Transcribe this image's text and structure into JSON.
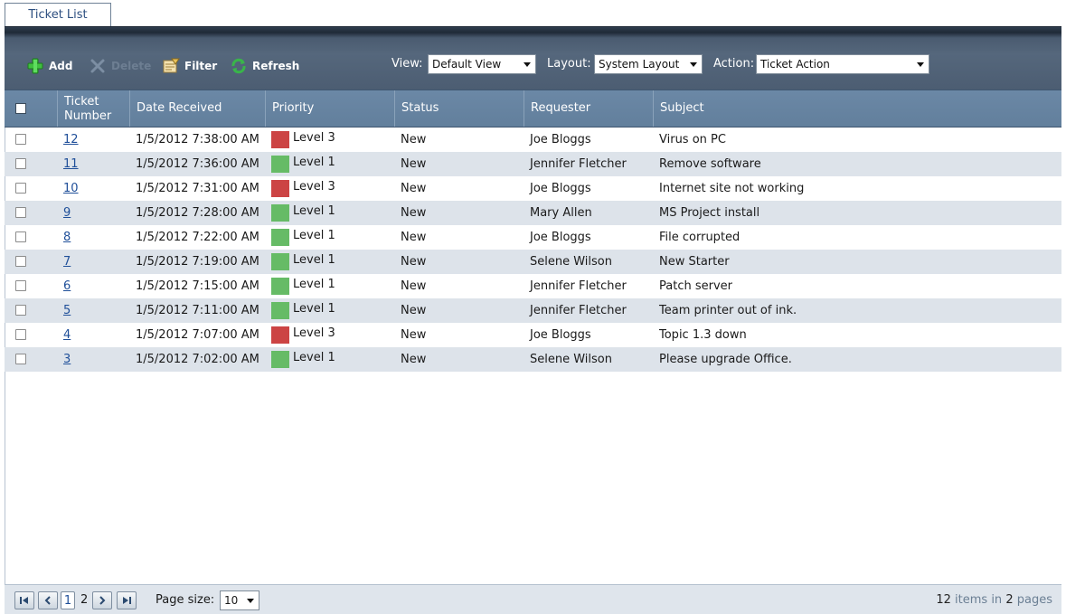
{
  "tab": {
    "label": "Ticket List"
  },
  "toolbar": {
    "add_label": "Add",
    "delete_label": "Delete",
    "filter_label": "Filter",
    "refresh_label": "Refresh",
    "view_label": "View:",
    "view_value": "Default View",
    "layout_label": "Layout:",
    "layout_value": "System Layout",
    "action_label": "Action:",
    "action_value": "Ticket Action"
  },
  "columns": {
    "ticket_number_line1": "Ticket",
    "ticket_number_line2": "Number",
    "date_received": "Date Received",
    "priority": "Priority",
    "status": "Status",
    "requester": "Requester",
    "subject": "Subject"
  },
  "rows": [
    {
      "id": "12",
      "date": "1/5/2012 7:38:00 AM",
      "priority": "Level 3",
      "priority_color": "#cc4444",
      "status": "New",
      "requester": "Joe Bloggs",
      "subject": "Virus on PC"
    },
    {
      "id": "11",
      "date": "1/5/2012 7:36:00 AM",
      "priority": "Level 1",
      "priority_color": "#66bb66",
      "status": "New",
      "requester": "Jennifer Fletcher",
      "subject": "Remove software"
    },
    {
      "id": "10",
      "date": "1/5/2012 7:31:00 AM",
      "priority": "Level 3",
      "priority_color": "#cc4444",
      "status": "New",
      "requester": "Joe Bloggs",
      "subject": "Internet site not working"
    },
    {
      "id": "9",
      "date": "1/5/2012 7:28:00 AM",
      "priority": "Level 1",
      "priority_color": "#66bb66",
      "status": "New",
      "requester": "Mary Allen",
      "subject": "MS Project install"
    },
    {
      "id": "8",
      "date": "1/5/2012 7:22:00 AM",
      "priority": "Level 1",
      "priority_color": "#66bb66",
      "status": "New",
      "requester": "Joe Bloggs",
      "subject": "File corrupted"
    },
    {
      "id": "7",
      "date": "1/5/2012 7:19:00 AM",
      "priority": "Level 1",
      "priority_color": "#66bb66",
      "status": "New",
      "requester": "Selene Wilson",
      "subject": "New Starter"
    },
    {
      "id": "6",
      "date": "1/5/2012 7:15:00 AM",
      "priority": "Level 1",
      "priority_color": "#66bb66",
      "status": "New",
      "requester": "Jennifer Fletcher",
      "subject": "Patch server"
    },
    {
      "id": "5",
      "date": "1/5/2012 7:11:00 AM",
      "priority": "Level 1",
      "priority_color": "#66bb66",
      "status": "New",
      "requester": "Jennifer Fletcher",
      "subject": "Team printer out of ink."
    },
    {
      "id": "4",
      "date": "1/5/2012 7:07:00 AM",
      "priority": "Level 3",
      "priority_color": "#cc4444",
      "status": "New",
      "requester": "Joe Bloggs",
      "subject": "Topic 1.3 down"
    },
    {
      "id": "3",
      "date": "1/5/2012 7:02:00 AM",
      "priority": "Level 1",
      "priority_color": "#66bb66",
      "status": "New",
      "requester": "Selene Wilson",
      "subject": "Please upgrade Office."
    }
  ],
  "pager": {
    "page1": "1",
    "page2": "2",
    "page_size_label": "Page size:",
    "page_size_value": "10",
    "total_items": "12",
    "items_in_text": "items in",
    "total_pages": "2",
    "pages_text": "pages"
  },
  "colors": {
    "toolbar_bg": "#4c5d72",
    "header_bg": "#6b88a6",
    "alt_row_bg": "#dde3ea",
    "link": "#1f4f99",
    "priority_high": "#cc4444",
    "priority_low": "#66bb66"
  }
}
